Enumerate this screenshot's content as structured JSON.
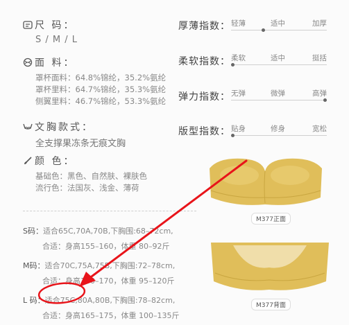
{
  "size": {
    "title": "尺  码：",
    "value": "S / M / L",
    "icon": "document-icon"
  },
  "material": {
    "title": "面  料：",
    "icon": "yarn-icon",
    "lines": [
      "罩杯面料：64.8%锦纶，35.2%氨纶",
      "罩杯里料：64.7%锦纶，35.3%氨纶",
      "侧翼里料：46.7%锦纶，53.3%氨纶"
    ]
  },
  "style": {
    "title": "文胸款式：",
    "icon": "bra-icon",
    "value": "全支撑果冻条无痕文胸"
  },
  "color": {
    "title": "颜  色：",
    "icon": "brush-icon",
    "lines": [
      "基础色：黑色、自然肤、裸肤色",
      "流行色：法国灰、浅金、薄荷"
    ]
  },
  "indices": [
    {
      "label": "厚薄指数：",
      "scale": [
        "轻薄",
        "适中",
        "加厚"
      ],
      "level": 0.33
    },
    {
      "label": "柔软指数：",
      "scale": [
        "柔软",
        "适中",
        "挺括"
      ],
      "level": 0.0
    },
    {
      "label": "弹力指数：",
      "scale": [
        "无弹",
        "微弹",
        "高弹"
      ],
      "level": 1.0
    },
    {
      "label": "版型指数：",
      "scale": [
        "贴身",
        "修身",
        "宽松"
      ],
      "level": 0.0
    }
  ],
  "sizes": [
    {
      "key": "S码：",
      "line1": "适合65C,70A,70B,下胸围:68–72cm,",
      "line2": "合适：身高155–160，体重 80–92斤"
    },
    {
      "key": "M码：",
      "line1": "适合70C,75A,75B,下胸围:72–78cm,",
      "line2": "合适：身高160–170，体重 95–120斤"
    },
    {
      "key": "L 码：",
      "line1": "适合75C,80A,80B,下胸围:78–82cm,",
      "line2": "合适：身高165–175，体重 100–135斤"
    }
  ],
  "products": {
    "front_caption": "M377正面",
    "back_caption": "M377背面",
    "bra_color": "#e0be5a"
  },
  "annotation_color": "#e8141a"
}
